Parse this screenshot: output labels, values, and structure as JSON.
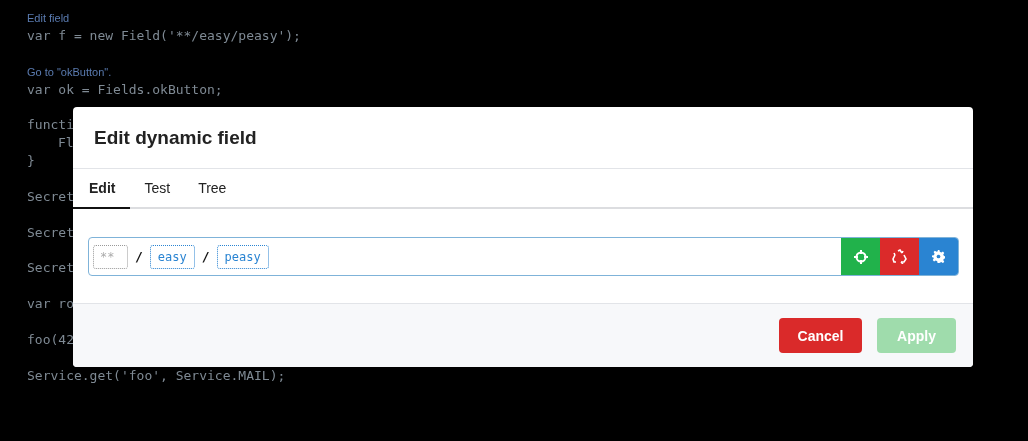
{
  "editor": {
    "lines": [
      {
        "kind": "comment",
        "text": "Edit field"
      },
      {
        "kind": "code",
        "text": "var f = new Field('**/easy/peasy');"
      },
      {
        "kind": "blank"
      },
      {
        "kind": "comment",
        "text": "Go to \"okButton\"."
      },
      {
        "kind": "code",
        "text": "var ok = Fields.okButton;"
      },
      {
        "kind": "blank"
      },
      {
        "kind": "code",
        "text": "functi"
      },
      {
        "kind": "indented",
        "text": "Fl"
      },
      {
        "kind": "code",
        "text": "}"
      },
      {
        "kind": "blank"
      },
      {
        "kind": "code",
        "text": "Secret"
      },
      {
        "kind": "blank"
      },
      {
        "kind": "code",
        "text": "Secret"
      },
      {
        "kind": "blank"
      },
      {
        "kind": "code",
        "text": "Secret"
      },
      {
        "kind": "blank"
      },
      {
        "kind": "code",
        "text": "var ro"
      },
      {
        "kind": "blank"
      },
      {
        "kind": "code",
        "text": "foo(42"
      },
      {
        "kind": "blank"
      },
      {
        "kind": "code",
        "text": "Service.get('foo', Service.MAIL);"
      }
    ]
  },
  "dialog": {
    "title": "Edit dynamic field",
    "tabs": [
      {
        "label": "Edit",
        "selected": true
      },
      {
        "label": "Test",
        "selected": false
      },
      {
        "label": "Tree",
        "selected": false
      }
    ],
    "path": [
      {
        "kind": "input",
        "placeholder": "**"
      },
      {
        "kind": "separator",
        "text": "/"
      },
      {
        "kind": "segment",
        "text": "easy"
      },
      {
        "kind": "separator",
        "text": "/"
      },
      {
        "kind": "segment",
        "text": "peasy"
      }
    ],
    "actions": [
      {
        "kind": "target"
      },
      {
        "kind": "recycle"
      },
      {
        "kind": "settings"
      }
    ],
    "buttons": [
      {
        "kind": "danger",
        "label": "Cancel",
        "disabled": false
      },
      {
        "kind": "primary",
        "label": "Apply",
        "disabled": true
      }
    ]
  }
}
